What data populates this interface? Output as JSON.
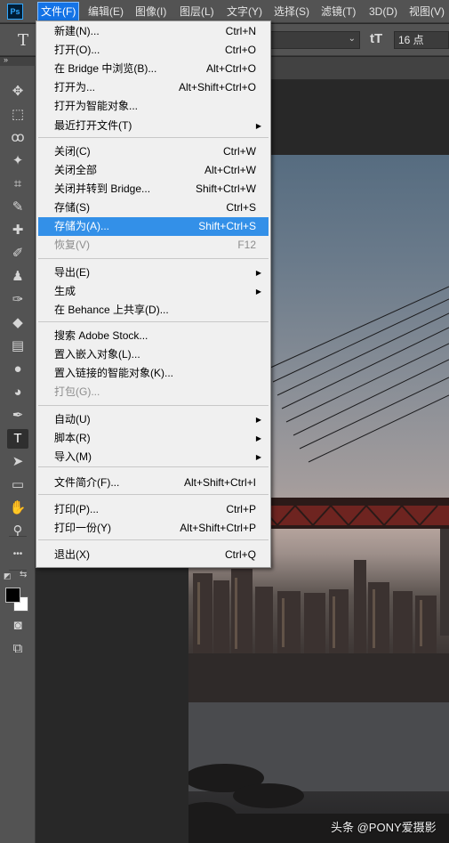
{
  "app": {
    "logo_text": "Ps"
  },
  "menubar": {
    "items": [
      {
        "label": "文件(F)"
      },
      {
        "label": "编辑(E)"
      },
      {
        "label": "图像(I)"
      },
      {
        "label": "图层(L)"
      },
      {
        "label": "文字(Y)"
      },
      {
        "label": "选择(S)"
      },
      {
        "label": "滤镜(T)"
      },
      {
        "label": "3D(D)"
      },
      {
        "label": "视图(V)"
      }
    ]
  },
  "options_bar": {
    "type_icon": "T",
    "font_dropdown_value": "",
    "size_icon": "tT",
    "font_size": "16 点"
  },
  "collapse_arrows": "»",
  "file_menu": {
    "items": [
      {
        "label": "新建(N)...",
        "shortcut": "Ctrl+N"
      },
      {
        "label": "打开(O)...",
        "shortcut": "Ctrl+O"
      },
      {
        "label": "在 Bridge 中浏览(B)...",
        "shortcut": "Alt+Ctrl+O"
      },
      {
        "label": "打开为...",
        "shortcut": "Alt+Shift+Ctrl+O"
      },
      {
        "label": "打开为智能对象...",
        "shortcut": ""
      },
      {
        "label": "最近打开文件(T)",
        "shortcut": "",
        "submenu": true
      },
      {
        "label": "关闭(C)",
        "shortcut": "Ctrl+W"
      },
      {
        "label": "关闭全部",
        "shortcut": "Alt+Ctrl+W"
      },
      {
        "label": "关闭并转到 Bridge...",
        "shortcut": "Shift+Ctrl+W"
      },
      {
        "label": "存储(S)",
        "shortcut": "Ctrl+S"
      },
      {
        "label": "存储为(A)...",
        "shortcut": "Shift+Ctrl+S",
        "highlighted": true
      },
      {
        "label": "恢复(V)",
        "shortcut": "F12",
        "disabled": true
      },
      {
        "label": "导出(E)",
        "shortcut": "",
        "submenu": true
      },
      {
        "label": "生成",
        "shortcut": "",
        "submenu": true
      },
      {
        "label": "在 Behance 上共享(D)...",
        "shortcut": ""
      },
      {
        "label": "搜索 Adobe Stock...",
        "shortcut": ""
      },
      {
        "label": "置入嵌入对象(L)...",
        "shortcut": ""
      },
      {
        "label": "置入链接的智能对象(K)...",
        "shortcut": ""
      },
      {
        "label": "打包(G)...",
        "shortcut": "",
        "disabled": true
      },
      {
        "label": "自动(U)",
        "shortcut": "",
        "submenu": true
      },
      {
        "label": "脚本(R)",
        "shortcut": "",
        "submenu": true
      },
      {
        "label": "导入(M)",
        "shortcut": "",
        "submenu": true
      },
      {
        "label": "文件简介(F)...",
        "shortcut": "Alt+Shift+Ctrl+I"
      },
      {
        "label": "打印(P)...",
        "shortcut": "Ctrl+P"
      },
      {
        "label": "打印一份(Y)",
        "shortcut": "Alt+Shift+Ctrl+P"
      },
      {
        "label": "退出(X)",
        "shortcut": "Ctrl+Q"
      }
    ],
    "submenu_glyph": "▶"
  },
  "toolbar": {
    "tools": [
      {
        "name": "move-tool",
        "glyph": "✥"
      },
      {
        "name": "marquee-tool",
        "glyph": "⬚"
      },
      {
        "name": "lasso-tool",
        "glyph": "ꝏ"
      },
      {
        "name": "magic-wand-tool",
        "glyph": "✦"
      },
      {
        "name": "crop-tool",
        "glyph": "⌗"
      },
      {
        "name": "eyedropper-tool",
        "glyph": "✎"
      },
      {
        "name": "healing-brush-tool",
        "glyph": "✚"
      },
      {
        "name": "brush-tool",
        "glyph": "✐"
      },
      {
        "name": "clone-stamp-tool",
        "glyph": "♟"
      },
      {
        "name": "history-brush-tool",
        "glyph": "✑"
      },
      {
        "name": "eraser-tool",
        "glyph": "◆"
      },
      {
        "name": "gradient-tool",
        "glyph": "▤"
      },
      {
        "name": "blur-tool",
        "glyph": "●"
      },
      {
        "name": "dodge-tool",
        "glyph": "◕"
      },
      {
        "name": "pen-tool",
        "glyph": "✒"
      },
      {
        "name": "type-tool",
        "glyph": "T",
        "active": true
      },
      {
        "name": "path-selection-tool",
        "glyph": "➤"
      },
      {
        "name": "rectangle-tool",
        "glyph": "▭"
      },
      {
        "name": "hand-tool",
        "glyph": "✋"
      },
      {
        "name": "zoom-tool",
        "glyph": "⚲"
      },
      {
        "name": "more-tools",
        "glyph": "•••"
      },
      {
        "name": "quick-mask",
        "glyph": "◙"
      },
      {
        "name": "screen-mode",
        "glyph": "⧉"
      }
    ],
    "swap_glyph": "⇆",
    "default_colors_glyph": "◩",
    "foreground_color": "#000000",
    "background_color": "#ffffff"
  },
  "colors": {
    "menubar_bg": "#535353",
    "menu_highlight": "#3390e8",
    "active_menu": "#1473e6",
    "menu_bg": "#f0f0f0"
  },
  "watermark": "头条 @PONY爱摄影"
}
